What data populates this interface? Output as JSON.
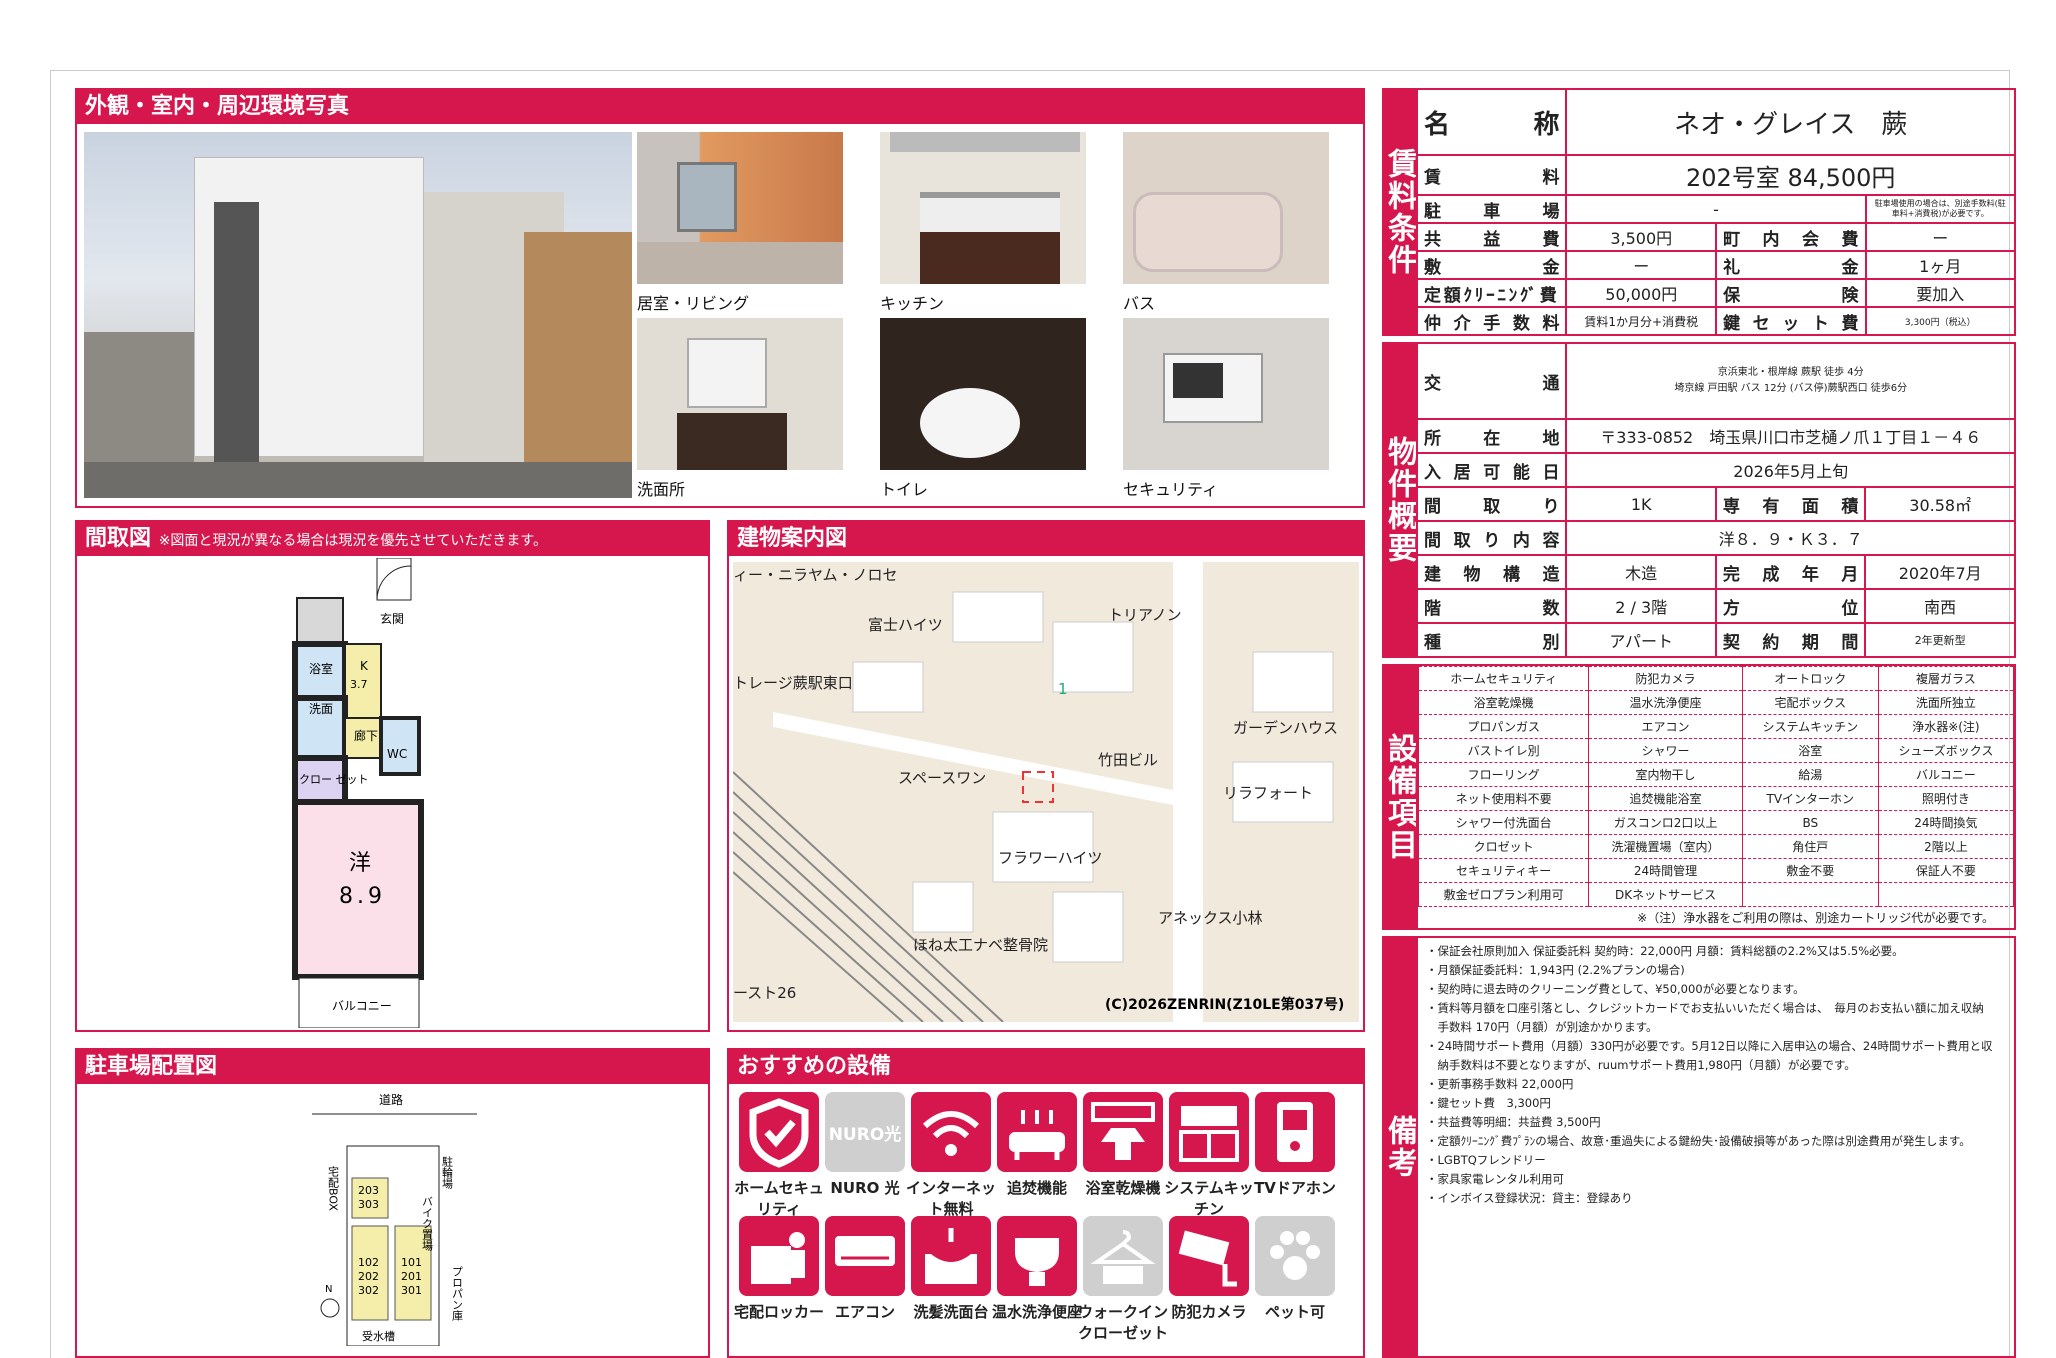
{
  "photos": {
    "title": "外観・室内・周辺環境写真",
    "captions": [
      "居室・リビング",
      "キッチン",
      "バス",
      "洗面所",
      "トイレ",
      "セキュリティ"
    ]
  },
  "floorplan": {
    "title": "間取図",
    "note": "※図面と現況が異なる場合は現況を優先させていただきます。",
    "labels": {
      "entrance": "玄関",
      "bath": "浴室",
      "k": "K",
      "k_size": "3.7",
      "wash": "洗面",
      "hall": "廊下",
      "closet": "クロー ゼット",
      "wc": "WC",
      "room": "洋",
      "room_size": "8.9",
      "balcony": "バルコニー"
    }
  },
  "map": {
    "title": "建物案内図",
    "labels": [
      "ィー・ニラヤム・ノロセ",
      "富士ハイツ",
      "トリアノン",
      "トレージ蕨駅東口",
      "ガーデンハウス",
      "竹田ビル",
      "スペースワン",
      "リラフォート",
      "フラワーハイツ",
      "アネックス小林",
      "ほね太工ナベ整骨院",
      "ースト26",
      "1"
    ],
    "copyright": "(C)2026ZENRIN(Z10LE第037号)"
  },
  "parking": {
    "title": "駐車場配置図",
    "labels": {
      "road": "道路",
      "takuhai": "宅配BOX",
      "bike": "駐輪場",
      "motor": "バイク置場",
      "propane": "プロパン庫",
      "tank": "受水槽",
      "r1": "203",
      "r2": "303",
      "r3": "102",
      "r4": "202",
      "r5": "302",
      "r6": "101",
      "r7": "201",
      "r8": "301",
      "north": "N"
    }
  },
  "recommend": {
    "title": "おすすめの設備",
    "items": [
      {
        "label": "ホームセキュリティ",
        "icon": "shield-icon",
        "active": true
      },
      {
        "label": "NURO 光",
        "icon": "nuro-icon",
        "active": false,
        "logo": "NURO光"
      },
      {
        "label": "インターネット無料",
        "icon": "wifi-icon",
        "active": true
      },
      {
        "label": "追焚機能",
        "icon": "bath-icon",
        "active": true
      },
      {
        "label": "浴室乾燥機",
        "icon": "dryer-icon",
        "active": true
      },
      {
        "label": "システムキッチン",
        "icon": "kitchen-icon",
        "active": true
      },
      {
        "label": "TVドアホン",
        "icon": "intercom-icon",
        "active": true
      },
      {
        "label": "宅配ロッカー",
        "icon": "locker-icon",
        "active": true
      },
      {
        "label": "エアコン",
        "icon": "aircon-icon",
        "active": true
      },
      {
        "label": "洗髪洗面台",
        "icon": "washbasin-icon",
        "active": true
      },
      {
        "label": "温水洗浄便座",
        "icon": "toilet-icon",
        "active": true
      },
      {
        "label": "ウォークインクローゼット",
        "icon": "closet-icon",
        "active": false
      },
      {
        "label": "防犯カメラ",
        "icon": "camera-icon",
        "active": true
      },
      {
        "label": "ペット可",
        "icon": "paw-icon",
        "active": false
      }
    ]
  },
  "rent": {
    "side": "賃料条件",
    "name_label": "名称",
    "name": "ネオ・グレイス　蕨",
    "rent_label": "賃料",
    "rent": "202号室 84,500円",
    "parking_label": "駐車場",
    "parking": "-",
    "parking_note": "駐車場使用の場合は、別途手数料(駐車料+消費税)が必要です。",
    "kyoeki_label": "共益費",
    "kyoeki": "3,500円",
    "chonai_label": "町内会費",
    "chonai": "ー",
    "shiki_label": "敷金",
    "shiki": "ー",
    "rei_label": "礼金",
    "rei": "1ヶ月",
    "clean_label": "定額ｸﾘｰﾆﾝｸﾞ費",
    "clean": "50,000円",
    "hoken_label": "保険",
    "hoken": "要加入",
    "chukai_label": "仲介手数料",
    "chukai": "賃料1か月分+消費税",
    "key_label": "鍵セット費",
    "key": "3,300円（税込）"
  },
  "outline": {
    "side": "物件概要",
    "kotsu_label": "交通",
    "kotsu1": "京浜東北・根岸線 蕨駅 徒歩 4分",
    "kotsu2": "埼京線 戸田駅 バス 12分 (バス停)蕨駅西口 徒歩6分",
    "addr_label": "所在地",
    "addr": "〒333-0852　埼玉県川口市芝樋ノ爪１丁目１－４６",
    "nyukyo_label": "入居可能日",
    "nyukyo": "2026年5月上旬",
    "madori_label": "間取り",
    "madori": "1K",
    "menseki_label": "専有面積",
    "menseki": "30.58㎡",
    "naiyo_label": "間取り内容",
    "naiyo": "洋８．９・Ｋ３．７",
    "kozo_label": "建物構造",
    "kozo": "木造",
    "kansei_label": "完成年月",
    "kansei": "2020年7月",
    "kai_label": "階数",
    "kai": "2 / 3階",
    "hoi_label": "方位",
    "hoi": "南西",
    "shubetsu_label": "種別",
    "shubetsu": "アパート",
    "keiyaku_label": "契約期間",
    "keiyaku": "2年更新型"
  },
  "equipment": {
    "side": "設備項目",
    "rows": [
      [
        "ホームセキュリティ",
        "防犯カメラ",
        "オートロック",
        "複層ガラス"
      ],
      [
        "浴室乾燥機",
        "温水洗浄便座",
        "宅配ボックス",
        "洗面所独立"
      ],
      [
        "プロパンガス",
        "エアコン",
        "システムキッチン",
        "浄水器※(注)"
      ],
      [
        "バストイレ別",
        "シャワー",
        "浴室",
        "シューズボックス"
      ],
      [
        "フローリング",
        "室内物干し",
        "給湯",
        "バルコニー"
      ],
      [
        "ネット使用料不要",
        "追焚機能浴室",
        "TVインターホン",
        "照明付き"
      ],
      [
        "シャワー付洗面台",
        "ガスコンロ2口以上",
        "BS",
        "24時間換気"
      ],
      [
        "クロゼット",
        "洗濯機置場（室内）",
        "角住戸",
        "2階以上"
      ],
      [
        "セキュリティキー",
        "24時間管理",
        "敷金不要",
        "保証人不要"
      ],
      [
        "敷金ゼロプラン利用可",
        "DKネットサービス",
        "",
        ""
      ]
    ],
    "note": "※（注）浄水器をご利用の際は、別途カートリッジ代が必要です。"
  },
  "remarks": {
    "side": "備考",
    "lines": [
      "・保証会社原則加入 保証委託料 契約時：22,000円 月額：賃料総額の2.2%又は5.5%必要。",
      "・月額保証委託料：1,943円 (2.2%プランの場合)",
      "・契約時に退去時のクリーニング費として、¥50,000が必要となります。",
      "・賃料等月額を口座引落とし、クレジットカードでお支払いいただく場合は、　毎月のお支払い額に加え収納",
      "　手数料 170円（月額）が別途かかります。",
      "・24時間サポート費用（月額）330円が必要です。5月12日以降に入居申込の場合、24時間サポート費用と収",
      "　納手数料は不要となりますが、ruumサポート費用1,980円（月額）が必要です。",
      "・更新事務手数料 22,000円",
      "・鍵セット費　3,300円",
      "・共益費等明細：共益費 3,500円",
      "・定額ｸﾘｰﾆﾝｸﾞ費ﾌﾟﾗﾝの場合、故意･重過失による鍵紛失･設備破損等があった際は別途費用が発生します。",
      "・LGBTQフレンドリー",
      "・家具家電レンタル利用可",
      "・インボイス登録状況：貸主：登録あり"
    ]
  }
}
